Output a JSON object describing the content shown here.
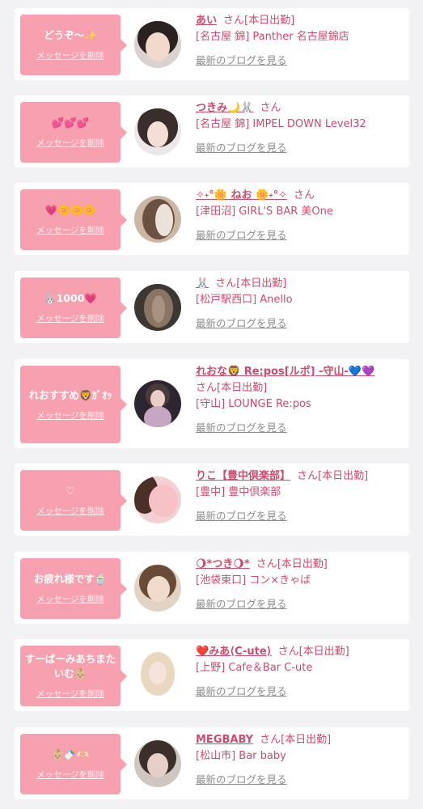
{
  "delete_label": "メッセージを削除",
  "blog_label": "最新のブログを見る",
  "san_label": "さん",
  "accent_color": "#f7a0b0",
  "text_color": "#d04a6e",
  "cards": [
    {
      "message": "どうぞ〜✨",
      "name": "あい",
      "status": "[本日出勤]",
      "shop": "[名古屋 錦] Panther 名古屋錦店",
      "avatar_icon": "user-photo"
    },
    {
      "message": "💕💕💕",
      "name": "つきみ🌙🐰",
      "status": "",
      "shop": "[名古屋 錦] IMPEL DOWN Level32",
      "avatar_icon": "user-photo"
    },
    {
      "message": "💗🌼🌼🌼",
      "name": "✧˖°🌼 ねお 🌼˖°✧",
      "status": "",
      "shop": "[津田沼] GIRL'S BAR 美One",
      "avatar_icon": "user-photo"
    },
    {
      "message": "🐰1000💗",
      "name": "🐰",
      "status": "[本日出勤]",
      "shop": "[松戸駅西口] Anello",
      "avatar_icon": "user-photo"
    },
    {
      "message": "れおすすめ🦁ｶﾞｵｯ",
      "name": "れおな🦁 Re:pos[ルポ] -守山-💙💜",
      "status": "[本日出勤]",
      "shop": "[守山] LOUNGE Re:pos",
      "avatar_icon": "user-photo"
    },
    {
      "message": "♡",
      "name": "りこ【豊中倶楽部】",
      "status": "[本日出勤]",
      "shop": "[豊中] 豊中倶楽部",
      "avatar_icon": "user-photo"
    },
    {
      "message": "お疲れ様です🍵",
      "name": "🌖*つき🌖*",
      "status": "[本日出勤]",
      "shop": "[池袋東口] コン×きゃば",
      "avatar_icon": "user-photo"
    },
    {
      "message": "すーぱーみあちまたいむ👶🏼",
      "name": "❤️みあ⟨C-ute⟩",
      "status": "[本日出勤]",
      "shop": "[上野] Cafe＆Bar C-ute",
      "avatar_icon": "user-photo"
    },
    {
      "message": "👶🏼🍼🫶🏻",
      "name": "MEGBABY",
      "status": "[本日出勤]",
      "shop": "[松山市] Bar baby",
      "avatar_icon": "user-photo"
    }
  ]
}
